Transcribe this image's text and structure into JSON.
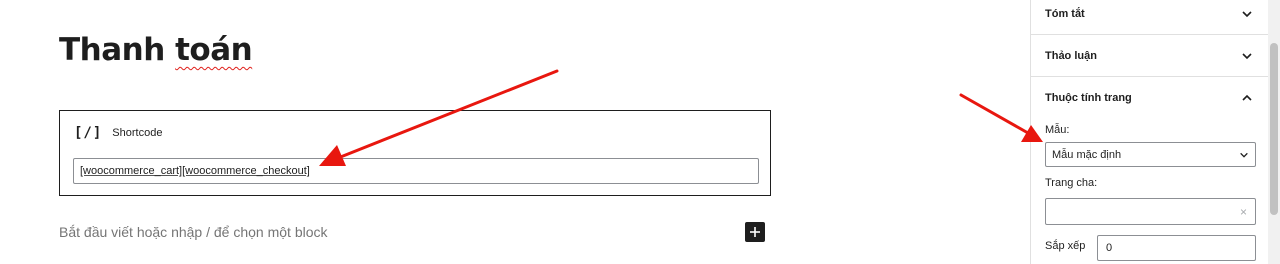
{
  "editor": {
    "title_part1": "Thanh ",
    "title_part2": "toán",
    "shortcode_block": {
      "icon": "[/]",
      "label": "Shortcode",
      "value": "[woocommerce_cart][woocommerce_checkout]"
    },
    "appender_placeholder": "Bắt đầu viết hoặc nhập / để chọn một block",
    "add_block_icon": "plus-icon"
  },
  "sidebar": {
    "panels": [
      {
        "label": "Tóm tắt",
        "state": "collapsed"
      },
      {
        "label": "Thảo luận",
        "state": "collapsed"
      },
      {
        "label": "Thuộc tính trang",
        "state": "expanded"
      }
    ],
    "template": {
      "label": "Mẫu:",
      "value": "Mẫu mặc định"
    },
    "parent": {
      "label": "Trang cha:",
      "value": "",
      "clear_icon": "×"
    },
    "order": {
      "label": "Sắp xếp",
      "value": "0"
    }
  },
  "colors": {
    "annotation_arrow": "#e8170f",
    "text": "#1e1e1e",
    "border": "#8c8f94",
    "placeholder": "#757575"
  }
}
